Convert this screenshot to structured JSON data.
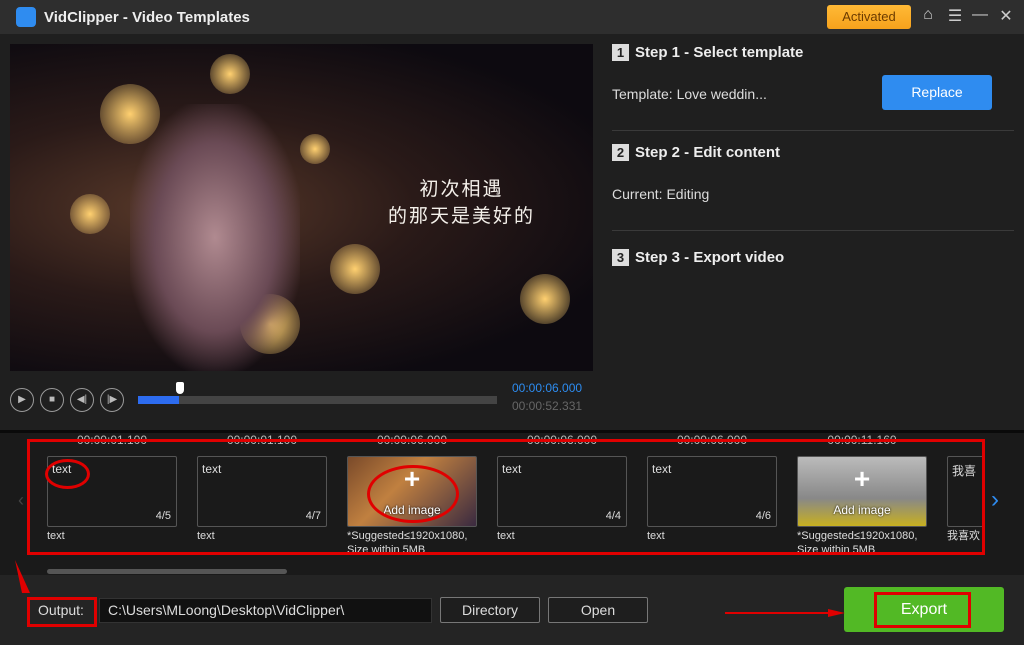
{
  "app": {
    "title": "VidClipper - Video Templates",
    "activated_label": "Activated"
  },
  "window_icons": [
    "home-icon",
    "menu-icon",
    "minimize-icon",
    "close-icon"
  ],
  "preview": {
    "caption_line1": "初次相遇",
    "caption_line2": "的那天是美好的",
    "current_time": "00:00:06.000",
    "total_time": "00:00:52.331",
    "progress_percent": 11.5
  },
  "steps": [
    {
      "num": "1",
      "title": "Step 1 - Select template",
      "detail": "Template: Love weddin...",
      "button": "Replace"
    },
    {
      "num": "2",
      "title": "Step 2 - Edit content",
      "detail": "Current: Editing"
    },
    {
      "num": "3",
      "title": "Step 3 - Export video"
    }
  ],
  "clips": [
    {
      "time": "00:00:01.100",
      "type": "text",
      "text": "text",
      "count": "4/5",
      "caption": "text"
    },
    {
      "time": "00:00:01.100",
      "type": "text",
      "text": "text",
      "count": "4/7",
      "caption": "text"
    },
    {
      "time": "00:00:06.000",
      "type": "image",
      "add_label": "Add image",
      "caption": "*Suggested≤1920x1080, Size within 5MB"
    },
    {
      "time": "00:00:06.000",
      "type": "text",
      "text": "text",
      "count": "4/4",
      "caption": "text"
    },
    {
      "time": "00:00:06.000",
      "type": "text",
      "text": "text",
      "count": "4/6",
      "caption": "text"
    },
    {
      "time": "00:00:11.160",
      "type": "image",
      "add_label": "Add image",
      "caption": "*Suggested≤1920x1080, Size within 5MB"
    },
    {
      "type": "text",
      "text": "我喜",
      "caption": "我喜欢"
    }
  ],
  "output": {
    "label": "Output:",
    "path": "C:\\Users\\MLoong\\Desktop\\VidClipper\\",
    "directory_button": "Directory",
    "open_button": "Open",
    "export_button": "Export"
  },
  "colors": {
    "accent": "#2f8cf0",
    "export": "#52b925",
    "activated": "#f6a21c",
    "annotation": "#e00000"
  }
}
